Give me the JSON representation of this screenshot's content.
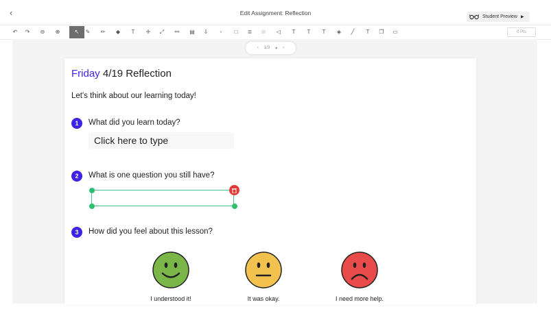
{
  "header": {
    "back_icon": "chevron-left-icon",
    "title": "Edit Assignment: Reflection",
    "preview_label": "Student Preview"
  },
  "toolbar": {
    "tools": [
      {
        "name": "undo",
        "glyph": "↶"
      },
      {
        "name": "redo",
        "glyph": "↷"
      },
      {
        "name": "zoom-out",
        "glyph": "⊖"
      },
      {
        "name": "zoom-in",
        "glyph": "⊕"
      },
      {
        "name": "select",
        "glyph": "↖"
      },
      {
        "name": "pen",
        "glyph": "✎"
      },
      {
        "name": "marker",
        "glyph": "✏"
      },
      {
        "name": "eraser",
        "glyph": "◆"
      },
      {
        "name": "text",
        "glyph": "T"
      },
      {
        "name": "move",
        "glyph": "✛"
      },
      {
        "name": "line",
        "glyph": "⤢"
      },
      {
        "name": "link",
        "glyph": "⚯"
      },
      {
        "name": "file",
        "glyph": "▤"
      },
      {
        "name": "upload",
        "glyph": "⇩"
      },
      {
        "name": "shapes",
        "glyph": "▫"
      },
      {
        "name": "rectangle",
        "glyph": "□"
      },
      {
        "name": "list",
        "glyph": "≣"
      },
      {
        "name": "star",
        "glyph": "☆"
      },
      {
        "name": "audio",
        "glyph": "◁"
      },
      {
        "name": "text-underline",
        "glyph": "T"
      },
      {
        "name": "text-size-up",
        "glyph": "T"
      },
      {
        "name": "text-size-down",
        "glyph": "T"
      },
      {
        "name": "fill",
        "glyph": "◈"
      },
      {
        "name": "draw-line",
        "glyph": "╱"
      },
      {
        "name": "text-style",
        "glyph": "T"
      },
      {
        "name": "duplicate",
        "glyph": "❐"
      },
      {
        "name": "trash",
        "glyph": "▭"
      }
    ],
    "points_label": "0 Pts"
  },
  "pager": {
    "label": "1/3"
  },
  "worksheet": {
    "title_highlight": "Friday",
    "title_rest": "4/19 Reflection",
    "intro": "Let's think about our learning today!",
    "questions": [
      {
        "number": "1",
        "text": "What did you learn today?"
      },
      {
        "number": "2",
        "text": "What is one question you still have?"
      },
      {
        "number": "3",
        "text": "How did you feel about this lesson?"
      }
    ],
    "answer_placeholder": "Click here to type",
    "faces": [
      {
        "label": "I understood it!",
        "icon": "happy-face-icon",
        "color": "#7ab648"
      },
      {
        "label": "It was okay.",
        "icon": "neutral-face-icon",
        "color": "#f2c14e"
      },
      {
        "label": "I need more help.",
        "icon": "sad-face-icon",
        "color": "#e84b49"
      }
    ]
  }
}
